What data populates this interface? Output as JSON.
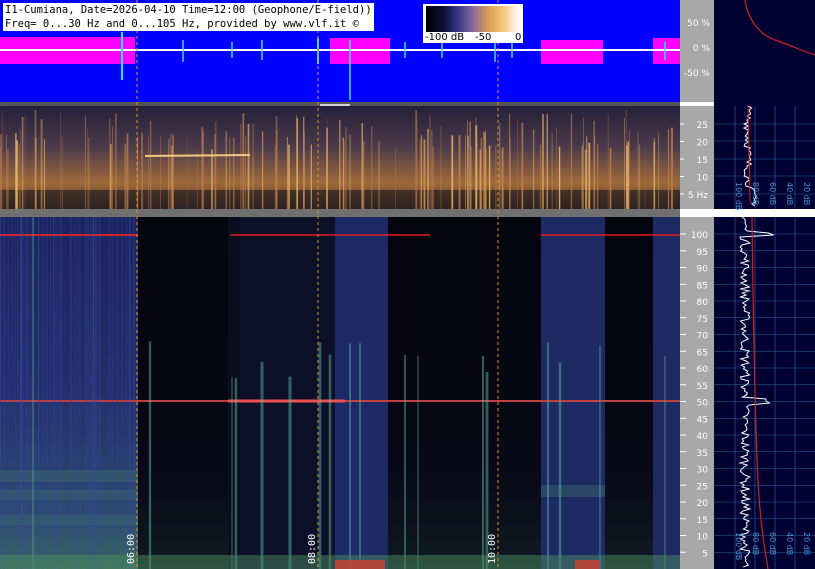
{
  "header": {
    "line1": "I1-Cumiana, Date=2026-04-10 Time=12:00 (Geophone/E-field))",
    "line2": "Freq= 0...30 Hz and 0...105 Hz, provided by www.vlf.it ©"
  },
  "colorbar": {
    "labels": [
      "-100 dB",
      "-50",
      "0"
    ]
  },
  "waveform_axis": {
    "ticks": [
      "50 %",
      "0 %",
      "-50 %"
    ]
  },
  "low_freq_axis": {
    "ticks": [
      "25",
      "20",
      "15",
      "10",
      "5 Hz"
    ]
  },
  "high_freq_axis": {
    "ticks": [
      "100",
      "95",
      "90",
      "85",
      "80",
      "75",
      "70",
      "65",
      "60",
      "55",
      "50",
      "45",
      "40",
      "35",
      "30",
      "25",
      "20",
      "15",
      "10",
      "5"
    ]
  },
  "time_markers": [
    "06:00",
    "08:00",
    "10:00"
  ],
  "side_panel_labels": {
    "low_top": [
      "100 dB",
      "80 dB",
      "60 dB",
      "40 dB",
      "20 dB"
    ],
    "high_bottom": [
      "100 dB",
      "80 dB",
      "60 dB",
      "40 dB",
      "20 dB"
    ]
  },
  "colors": {
    "waveform_bg": "#0000ff",
    "waveform_signal": "#ff00ff",
    "side_bg": "#000033",
    "axis_bg": "#a8a8a8"
  }
}
